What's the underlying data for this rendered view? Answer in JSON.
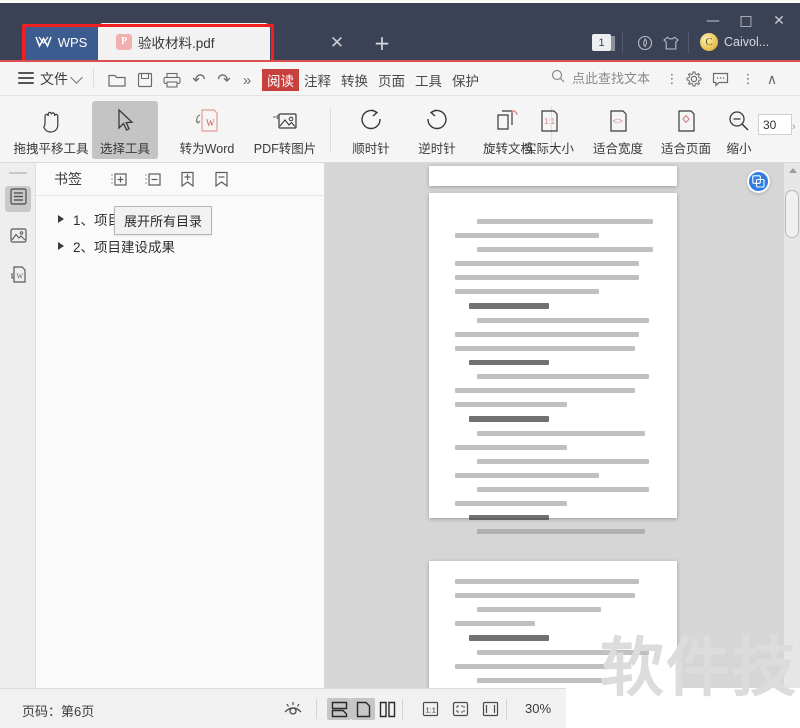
{
  "window": {
    "minimize_icon": "minimize-icon",
    "maximize_icon": "maximize-icon",
    "close_icon": "close-icon",
    "minimize_glyph": "—",
    "maximize_glyph": "□",
    "close_glyph": "✕",
    "tab_count_badge": "1",
    "account_name": "Caivol...",
    "account_initial": "C"
  },
  "tabs": {
    "home_label": "WPS",
    "document_label": "验收材料.pdf",
    "pdf_badge": "P",
    "close_glyph": "✕",
    "new_tab_glyph": "+"
  },
  "menubar": {
    "file_label": "文件",
    "quick_icons": [
      "open-folder-icon",
      "save-icon",
      "print-icon",
      "undo-icon",
      "redo-icon",
      "more-icon"
    ],
    "undo_glyph": "↶",
    "redo_glyph": "↷",
    "more_glyph": "»",
    "tabs": [
      {
        "label": "阅读",
        "active": true
      },
      {
        "label": "注释",
        "active": false
      },
      {
        "label": "转换",
        "active": false
      },
      {
        "label": "页面",
        "active": false
      },
      {
        "label": "工具",
        "active": false
      },
      {
        "label": "保护",
        "active": false
      }
    ],
    "search_placeholder": "点此查找文本",
    "right_icons": [
      "overflow-dots-icon",
      "settings-gear-icon",
      "feedback-icon",
      "more-dots-icon",
      "collapse-ribbon-icon"
    ],
    "dots_glyph": "⋮",
    "collapse_glyph": "∧"
  },
  "ribbon": {
    "items": [
      {
        "label": "拖拽平移工具",
        "icon": "hand-pan-icon",
        "selected": false
      },
      {
        "label": "选择工具",
        "icon": "cursor-select-icon",
        "selected": true
      },
      {
        "label": "转为Word",
        "icon": "convert-to-word-icon",
        "selected": false
      },
      {
        "label": "PDF转图片",
        "icon": "pdf-to-image-icon",
        "selected": false
      },
      {
        "label": "顺时针",
        "icon": "rotate-clockwise-icon",
        "selected": false
      },
      {
        "label": "逆时针",
        "icon": "rotate-counterclockwise-icon",
        "selected": false
      },
      {
        "label": "旋转文档",
        "icon": "rotate-document-icon",
        "selected": false
      },
      {
        "label": "实际大小",
        "icon": "actual-size-icon",
        "selected": false
      },
      {
        "label": "适合宽度",
        "icon": "fit-width-icon",
        "selected": false
      },
      {
        "label": "适合页面",
        "icon": "fit-page-icon",
        "selected": false
      },
      {
        "label": "缩小",
        "icon": "zoom-out-icon",
        "selected": false
      }
    ],
    "zoom_value": "30",
    "overflow_glyph": "›"
  },
  "rail": {
    "items": [
      {
        "icon": "bookmark-list-icon",
        "active": true
      },
      {
        "icon": "thumbnail-icon",
        "active": false
      },
      {
        "icon": "export-word-icon",
        "active": false
      }
    ]
  },
  "bookmarks": {
    "panel_title": "书签",
    "toolbar_icons": [
      "expand-all-icon",
      "collapse-all-icon",
      "add-bookmark-icon",
      "remove-bookmark-icon"
    ],
    "items": [
      {
        "label": "1、项目概况"
      },
      {
        "label": "2、项目建设成果"
      }
    ],
    "tooltip": "展开所有目录"
  },
  "viewer": {
    "side_button_icon": "translate-icon",
    "watermark": "软件技巧",
    "scroll_up_icon": "scroll-up-arrow-icon",
    "scrollbar_icon": "vertical-scrollbar"
  },
  "statusbar": {
    "page_label": "页码：第6页",
    "eye_icon": "reading-mode-icon",
    "view_icons": [
      {
        "icon": "continuous-scroll-icon",
        "active": true
      },
      {
        "icon": "single-page-icon",
        "active": true
      },
      {
        "icon": "facing-pages-icon",
        "active": false
      },
      {
        "icon": "actual-size-icon",
        "active": false
      },
      {
        "icon": "fit-page-icon",
        "active": false
      },
      {
        "icon": "fit-width-icon",
        "active": false
      }
    ],
    "zoom_level": "30%"
  },
  "colors": {
    "titlebar": "#3b4256",
    "wps_tab": "#3c5b8f",
    "accent_red": "#c8403e",
    "annotation_red": "#f42020",
    "side_button_blue": "#2f7de1"
  }
}
